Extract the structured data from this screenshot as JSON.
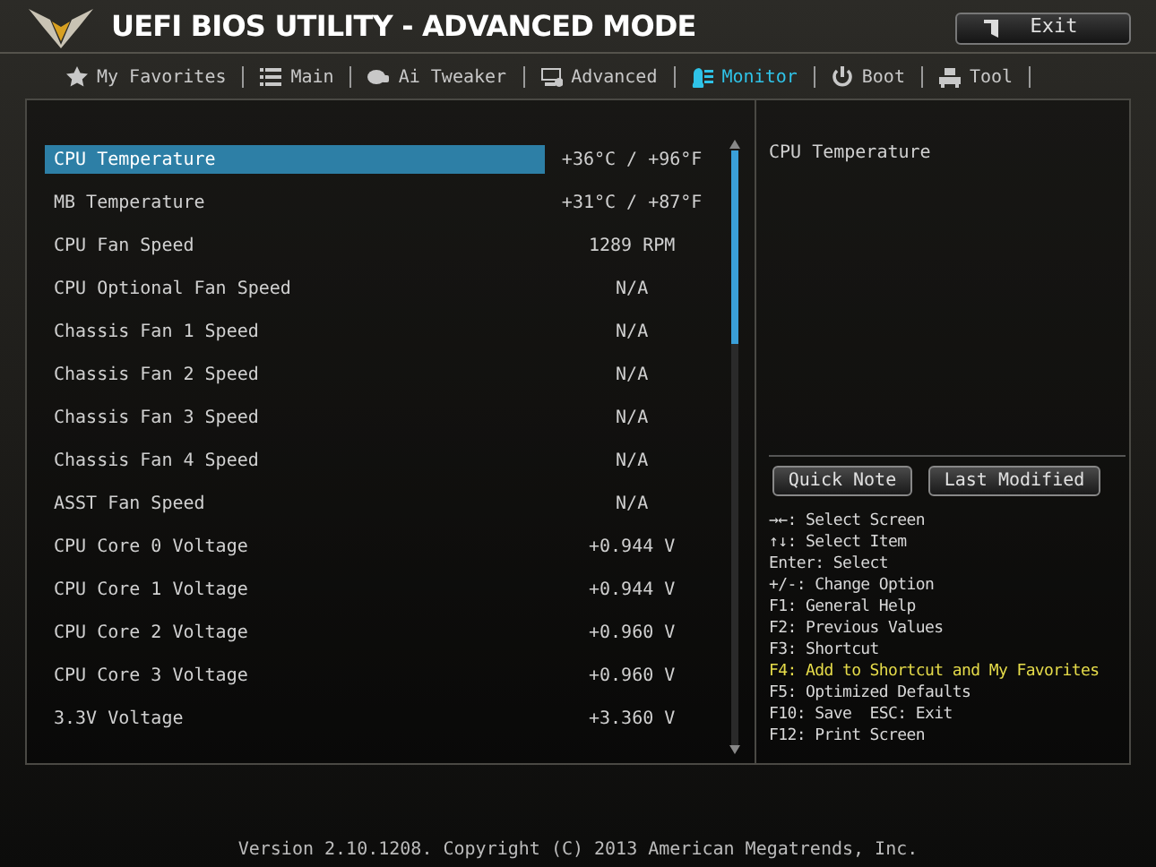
{
  "header": {
    "title": "UEFI BIOS UTILITY - ADVANCED MODE",
    "exit_button": "Exit"
  },
  "tabs": [
    {
      "label": "My Favorites",
      "kind": "star",
      "selected": false
    },
    {
      "label": "Main",
      "kind": "list",
      "selected": false
    },
    {
      "label": "Ai Tweaker",
      "kind": "tweak",
      "selected": false
    },
    {
      "label": "Advanced",
      "kind": "advanced",
      "selected": false
    },
    {
      "label": "Monitor",
      "kind": "monitor",
      "selected": true
    },
    {
      "label": "Boot",
      "kind": "power",
      "selected": false
    },
    {
      "label": "Tool",
      "kind": "tool",
      "selected": false
    }
  ],
  "items": [
    {
      "name": "CPU Temperature",
      "value": "+36°C / +96°F",
      "selected": true
    },
    {
      "name": "MB Temperature",
      "value": "+31°C / +87°F",
      "selected": false
    },
    {
      "name": "CPU Fan Speed",
      "value": "1289 RPM",
      "selected": false
    },
    {
      "name": "CPU Optional Fan Speed",
      "value": "N/A",
      "selected": false
    },
    {
      "name": "Chassis Fan 1 Speed",
      "value": "N/A",
      "selected": false
    },
    {
      "name": "Chassis Fan 2 Speed",
      "value": "N/A",
      "selected": false
    },
    {
      "name": "Chassis Fan 3 Speed",
      "value": "N/A",
      "selected": false
    },
    {
      "name": "Chassis Fan 4 Speed",
      "value": "N/A",
      "selected": false
    },
    {
      "name": "ASST Fan Speed",
      "value": "N/A",
      "selected": false
    },
    {
      "name": "CPU Core 0 Voltage",
      "value": "+0.944 V",
      "selected": false
    },
    {
      "name": "CPU Core 1 Voltage",
      "value": "+0.944 V",
      "selected": false
    },
    {
      "name": "CPU Core 2 Voltage",
      "value": "+0.960 V",
      "selected": false
    },
    {
      "name": "CPU Core 3 Voltage",
      "value": "+0.960 V",
      "selected": false
    },
    {
      "name": "3.3V Voltage",
      "value": "+3.360 V",
      "selected": false
    }
  ],
  "description": "CPU Temperature",
  "buttons": [
    "Quick Note",
    "Last Modified"
  ],
  "help": [
    {
      "text": "→←: Select Screen",
      "highlighted": false
    },
    {
      "text": "↑↓: Select Item",
      "highlighted": false
    },
    {
      "text": "Enter: Select",
      "highlighted": false
    },
    {
      "text": "+/-: Change Option",
      "highlighted": false
    },
    {
      "text": "F1: General Help",
      "highlighted": false
    },
    {
      "text": "F2: Previous Values",
      "highlighted": false
    },
    {
      "text": "F3: Shortcut",
      "highlighted": false
    },
    {
      "text": "F4: Add to Shortcut and My Favorites",
      "highlighted": true
    },
    {
      "text": "F5: Optimized Defaults",
      "highlighted": false
    },
    {
      "text": "F10: Save  ESC: Exit",
      "highlighted": false
    },
    {
      "text": "F12: Print Screen",
      "highlighted": false
    }
  ],
  "footer": "Version 2.10.1208. Copyright (C) 2013 American Megatrends, Inc."
}
